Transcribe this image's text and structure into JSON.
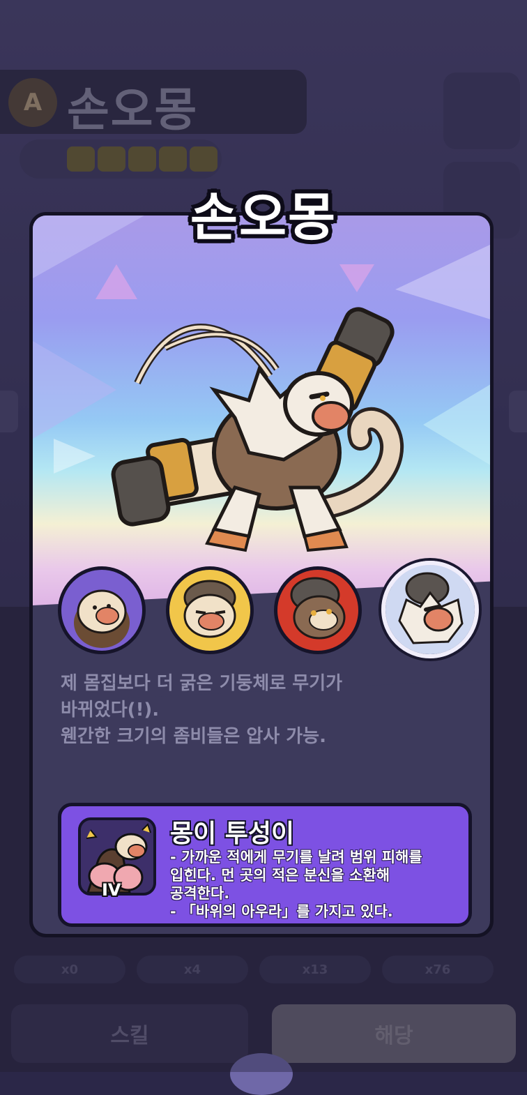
{
  "background": {
    "character_name": "손오몽",
    "pills": [
      "x0",
      "x4",
      "x13",
      "x76"
    ],
    "skin_button": "스킬",
    "equip_button": "해당"
  },
  "card": {
    "title": "손오몽",
    "forms": [
      "form-1",
      "form-2",
      "form-3",
      "form-4"
    ],
    "selected_form": 4,
    "description": [
      "제 몸집보다 더 굵은 기둥체로 무기가",
      "바뀌었다(!).",
      "웬간한 크기의 좀비들은 압사 가능."
    ],
    "skill": {
      "name": "몽이 투성이",
      "level": "IV",
      "lines": [
        "- 가까운 적에게 무기를 날려 범위 피해를",
        "입힌다. 먼 곳의 적은 분신을 소환해",
        "공격한다.",
        "- 「바위의 아우라」를 가지고 있다."
      ]
    }
  },
  "colors": {
    "card_bg": "#3d3a5c",
    "skill_bg": "#7d51e3",
    "form1_ring": "#7a5fd0",
    "form2_ring": "#f1c64a",
    "form3_ring": "#d43a2a",
    "form4_ring": "#f1eefb"
  }
}
